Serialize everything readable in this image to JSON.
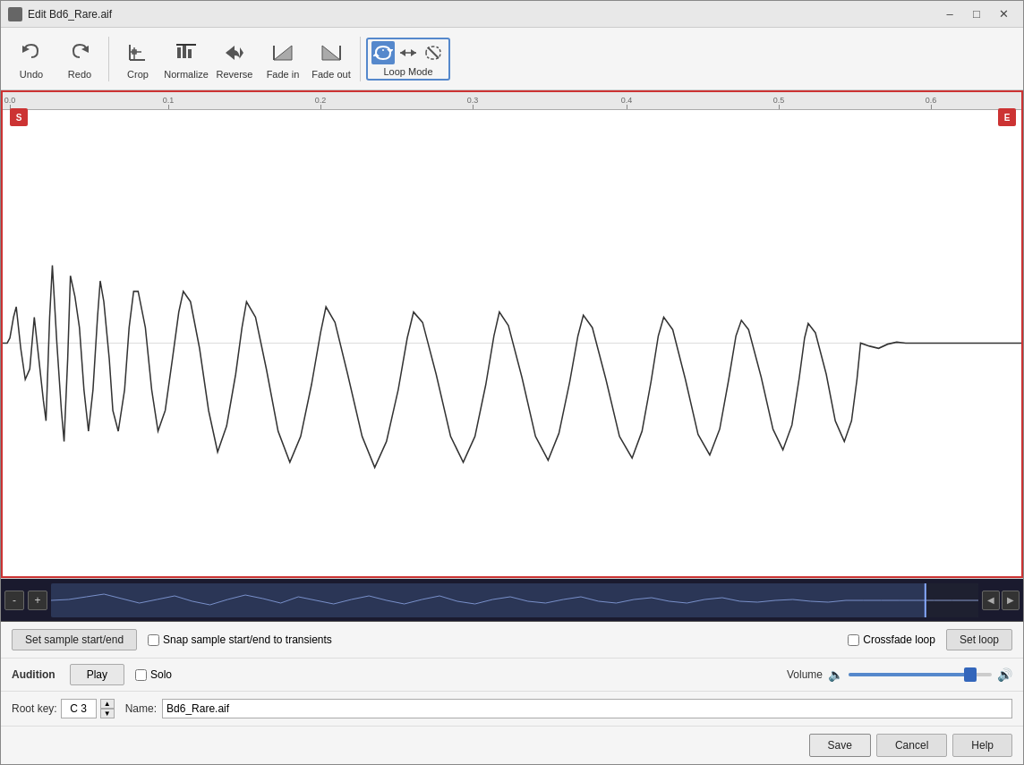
{
  "window": {
    "title": "Edit Bd6_Rare.aif",
    "icon": "edit-icon"
  },
  "toolbar": {
    "undo_label": "Undo",
    "redo_label": "Redo",
    "crop_label": "Crop",
    "normalize_label": "Normalize",
    "reverse_label": "Reverse",
    "fade_in_label": "Fade in",
    "fade_out_label": "Fade out",
    "loop_mode_label": "Loop Mode"
  },
  "ruler": {
    "ticks": [
      {
        "pos": 0,
        "label": "0.0"
      },
      {
        "pos": 170,
        "label": "0.1"
      },
      {
        "pos": 340,
        "label": "0.2"
      },
      {
        "pos": 510,
        "label": "0.3"
      },
      {
        "pos": 680,
        "label": "0.4"
      },
      {
        "pos": 850,
        "label": "0.5"
      },
      {
        "pos": 1020,
        "label": "0.6"
      }
    ],
    "marker_start": "S",
    "marker_end": "E"
  },
  "minimap": {
    "zoom_in_label": "+",
    "zoom_out_label": "-",
    "nav_left_label": "◀",
    "nav_right_label": "▶"
  },
  "controls": {
    "set_sample_label": "Set sample start/end",
    "snap_label": "Snap sample start/end to transients",
    "crossfade_label": "Crossfade loop",
    "set_loop_label": "Set loop"
  },
  "audition": {
    "section_label": "Audition",
    "play_label": "Play",
    "solo_label": "Solo",
    "volume_label": "Volume",
    "volume_pct": 85
  },
  "sample": {
    "root_key_label": "Root key:",
    "root_key_value": "C 3",
    "name_label": "Name:",
    "name_value": "Bd6_Rare.aif"
  },
  "footer": {
    "save_label": "Save",
    "cancel_label": "Cancel",
    "help_label": "Help"
  }
}
